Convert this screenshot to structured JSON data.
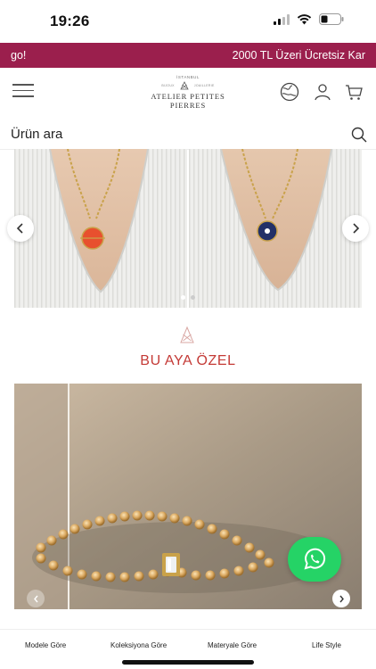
{
  "status_bar": {
    "time": "19:26"
  },
  "promo_banner": {
    "left_text": "go!",
    "right_text": "2000 TL Üzeri Ücretsiz Kar",
    "background": "#9b1f4d"
  },
  "header": {
    "logo": {
      "top_small": "İSTANBUL",
      "left_tiny": "BIJOUX",
      "right_tiny": "JOAILLERIE",
      "brand": "ATELIER PETITES PIERRES"
    },
    "icons": [
      "menu-icon",
      "globe-icon",
      "user-icon",
      "cart-icon"
    ]
  },
  "search": {
    "label": "Ürün ara",
    "icon": "search-icon"
  },
  "section": {
    "title": "BU AYA ÖZEL",
    "accent": "#c43a36"
  },
  "bottom_nav": {
    "items": [
      {
        "label": "Modele Göre"
      },
      {
        "label": "Koleksiyona Göre"
      },
      {
        "label": "Materyale Göre"
      },
      {
        "label": "Life Style"
      }
    ]
  },
  "colors": {
    "whatsapp": "#25d366"
  }
}
